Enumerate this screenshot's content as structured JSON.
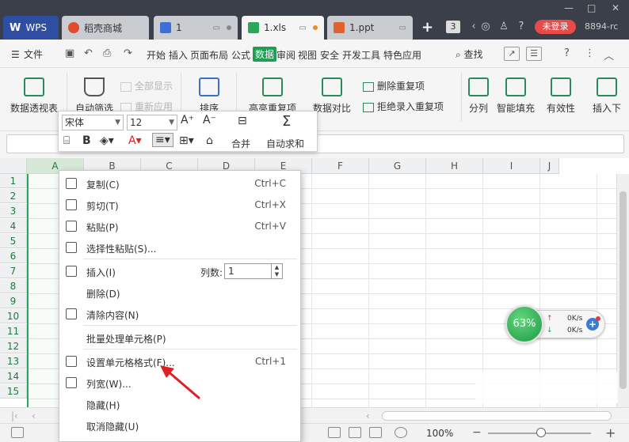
{
  "titlebar": {
    "tabs": [
      {
        "label": "WPS"
      },
      {
        "label": "稻壳商城"
      },
      {
        "label": "1"
      },
      {
        "label": "1.xls"
      },
      {
        "label": "1.ppt"
      }
    ],
    "tab_count": "3",
    "login_label": "未登录",
    "user_id": "8894-rc"
  },
  "menubar": {
    "file_label": "文件",
    "items": [
      "开始",
      "插入",
      "页面布局",
      "公式",
      "数据",
      "审阅",
      "视图",
      "安全",
      "开发工具",
      "特色应用"
    ],
    "active_item": "数据",
    "search_label": "查找"
  },
  "ribbon": {
    "pivot": "数据透视表",
    "autofilter": "自动筛选",
    "show_all": "全部显示",
    "reapply": "重新应用",
    "sort": "排序",
    "highlight_dup": "高亮重复项",
    "compare": "数据对比",
    "remove_dup": "删除重复项",
    "reject_dup": "拒绝录入重复项",
    "split": "分列",
    "smart_fill": "智能填充",
    "validity": "有效性",
    "insert_dropdown": "插入下"
  },
  "format_toolbar": {
    "font": "宋体",
    "size": "12",
    "merge": "合并",
    "autosum": "自动求和"
  },
  "grid": {
    "columns": [
      "A",
      "B",
      "C",
      "D",
      "E",
      "F",
      "G",
      "H",
      "I",
      "J"
    ],
    "selected_column": "A",
    "rows": [
      "1",
      "2",
      "3",
      "4",
      "5",
      "6",
      "7",
      "8",
      "9",
      "10",
      "11",
      "12",
      "13",
      "14",
      "15"
    ]
  },
  "context_menu": {
    "items": [
      {
        "label": "复制(C)",
        "shortcut": "Ctrl+C",
        "icon": "copy-icon"
      },
      {
        "label": "剪切(T)",
        "shortcut": "Ctrl+X",
        "icon": "cut-icon"
      },
      {
        "label": "粘贴(P)",
        "shortcut": "Ctrl+V",
        "icon": "paste-icon"
      },
      {
        "label": "选择性粘贴(S)...",
        "shortcut": "",
        "icon": "paste-special-icon"
      },
      {
        "label": "插入(I)",
        "shortcut": "",
        "icon": "insert-icon"
      },
      {
        "label": "删除(D)",
        "shortcut": "",
        "icon": ""
      },
      {
        "label": "清除内容(N)",
        "shortcut": "",
        "icon": "clear-icon"
      },
      {
        "label": "批量处理单元格(P)",
        "shortcut": "",
        "icon": ""
      },
      {
        "label": "设置单元格格式(F)...",
        "shortcut": "Ctrl+1",
        "icon": "format-cells-icon"
      },
      {
        "label": "列宽(W)...",
        "shortcut": "",
        "icon": "column-width-icon"
      },
      {
        "label": "隐藏(H)",
        "shortcut": "",
        "icon": ""
      },
      {
        "label": "取消隐藏(U)",
        "shortcut": "",
        "icon": ""
      }
    ],
    "column_count_label": "列数:",
    "column_count_value": "1"
  },
  "speed_widget": {
    "percent": "63%",
    "upload": "0K/s",
    "download": "0K/s"
  },
  "statusbar": {
    "zoom": "100%"
  },
  "colors": {
    "accent_green": "#1f9e54",
    "titlebar_bg": "#3b3f4a",
    "login_red": "#e84a4a",
    "annotation_red": "#e02020"
  }
}
